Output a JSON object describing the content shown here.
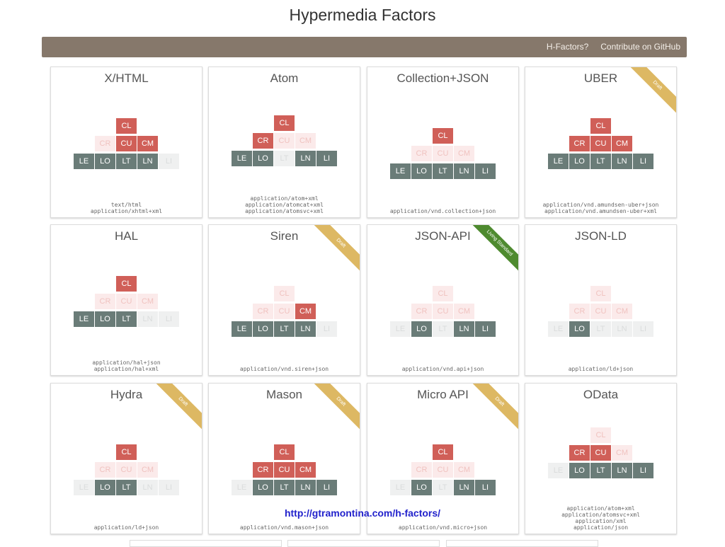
{
  "page": {
    "title": "Hypermedia Factors"
  },
  "nav": {
    "links": [
      "H-Factors?",
      "Contribute on GitHub"
    ]
  },
  "factor_labels": {
    "top": [
      "CL"
    ],
    "middle": [
      "CR",
      "CU",
      "CM"
    ],
    "bottom": [
      "LE",
      "LO",
      "LT",
      "LN",
      "LI"
    ]
  },
  "cards": [
    {
      "title": "X/HTML",
      "ribbon": null,
      "factors": {
        "CL": true,
        "CR": false,
        "CU": true,
        "CM": true,
        "LE": true,
        "LO": true,
        "LT": true,
        "LN": true,
        "LI": false
      },
      "media_types": [
        "text/html",
        "application/xhtml+xml"
      ]
    },
    {
      "title": "Atom",
      "ribbon": null,
      "factors": {
        "CL": true,
        "CR": true,
        "CU": false,
        "CM": false,
        "LE": true,
        "LO": true,
        "LT": false,
        "LN": true,
        "LI": true
      },
      "media_types": [
        "application/atom+xml",
        "application/atomcat+xml",
        "application/atomsvc+xml"
      ]
    },
    {
      "title": "Collection+JSON",
      "ribbon": null,
      "factors": {
        "CL": true,
        "CR": false,
        "CU": false,
        "CM": false,
        "LE": true,
        "LO": true,
        "LT": true,
        "LN": true,
        "LI": true
      },
      "media_types": [
        "application/vnd.collection+json"
      ]
    },
    {
      "title": "UBER",
      "ribbon": "Draft",
      "factors": {
        "CL": true,
        "CR": true,
        "CU": true,
        "CM": true,
        "LE": true,
        "LO": true,
        "LT": true,
        "LN": true,
        "LI": true
      },
      "media_types": [
        "application/vnd.amundsen-uber+json",
        "application/vnd.amundsen-uber+xml"
      ]
    },
    {
      "title": "HAL",
      "ribbon": null,
      "factors": {
        "CL": true,
        "CR": false,
        "CU": false,
        "CM": false,
        "LE": true,
        "LO": true,
        "LT": true,
        "LN": false,
        "LI": false
      },
      "media_types": [
        "application/hal+json",
        "application/hal+xml"
      ]
    },
    {
      "title": "Siren",
      "ribbon": "Draft",
      "factors": {
        "CL": false,
        "CR": false,
        "CU": false,
        "CM": true,
        "LE": true,
        "LO": true,
        "LT": true,
        "LN": true,
        "LI": false
      },
      "media_types": [
        "application/vnd.siren+json"
      ]
    },
    {
      "title": "JSON-API",
      "ribbon": "Living Standard",
      "factors": {
        "CL": false,
        "CR": false,
        "CU": false,
        "CM": false,
        "LE": false,
        "LO": true,
        "LT": false,
        "LN": true,
        "LI": true
      },
      "media_types": [
        "application/vnd.api+json"
      ]
    },
    {
      "title": "JSON-LD",
      "ribbon": null,
      "factors": {
        "CL": false,
        "CR": false,
        "CU": false,
        "CM": false,
        "LE": false,
        "LO": true,
        "LT": false,
        "LN": false,
        "LI": false
      },
      "media_types": [
        "application/ld+json"
      ]
    },
    {
      "title": "Hydra",
      "ribbon": "Draft",
      "factors": {
        "CL": true,
        "CR": false,
        "CU": false,
        "CM": false,
        "LE": false,
        "LO": true,
        "LT": true,
        "LN": false,
        "LI": false
      },
      "media_types": [
        "application/ld+json"
      ]
    },
    {
      "title": "Mason",
      "ribbon": "Draft",
      "factors": {
        "CL": true,
        "CR": true,
        "CU": true,
        "CM": true,
        "LE": false,
        "LO": true,
        "LT": true,
        "LN": true,
        "LI": true
      },
      "media_types": [
        "application/vnd.mason+json"
      ]
    },
    {
      "title": "Micro API",
      "ribbon": "Draft",
      "factors": {
        "CL": true,
        "CR": false,
        "CU": false,
        "CM": false,
        "LE": false,
        "LO": true,
        "LT": false,
        "LN": true,
        "LI": true
      },
      "media_types": [
        "application/vnd.micro+json"
      ]
    },
    {
      "title": "OData",
      "ribbon": null,
      "factors": {
        "CL": false,
        "CR": true,
        "CU": true,
        "CM": false,
        "LE": false,
        "LO": true,
        "LT": true,
        "LN": true,
        "LI": true
      },
      "media_types": [
        "application/atom+xml",
        "application/atomsvc+xml",
        "application/xml",
        "application/json"
      ]
    }
  ],
  "caption": {
    "url": "http://gtramontina.com/h-factors/"
  }
}
